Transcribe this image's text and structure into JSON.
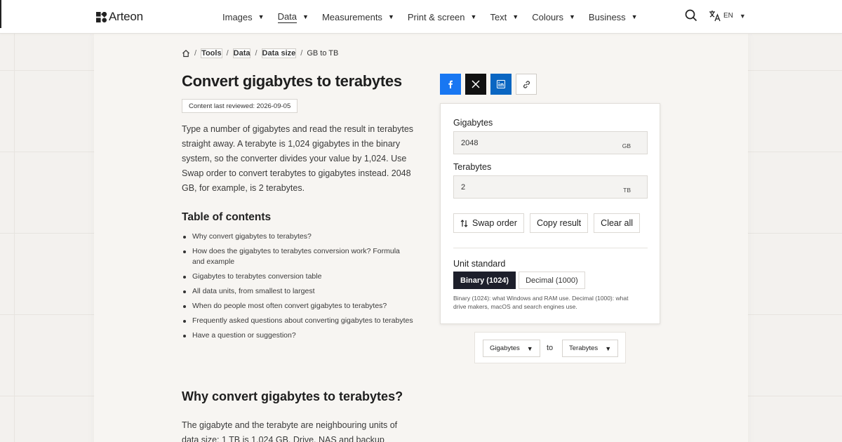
{
  "brand": {
    "name": "Arteon"
  },
  "nav": {
    "items": [
      {
        "label": "Images",
        "active": false
      },
      {
        "label": "Data",
        "active": true
      },
      {
        "label": "Measurements",
        "active": false
      },
      {
        "label": "Print & screen",
        "active": false
      },
      {
        "label": "Text",
        "active": false
      },
      {
        "label": "Colours",
        "active": false
      },
      {
        "label": "Business",
        "active": false
      }
    ],
    "caret": "▼",
    "search_icon": "search-icon",
    "language": {
      "code": "EN",
      "icon": "translate-icon"
    }
  },
  "breadcrumb": {
    "home_icon": "home-icon",
    "items": [
      "Tools",
      "Data",
      "Data size",
      "GB to TB"
    ]
  },
  "page": {
    "title": "Convert gigabytes to terabytes",
    "reviewed": "Content last reviewed: 2026-09-05",
    "intro": "Type a number of gigabytes and read the result in terabytes straight away. A terabyte is 1,024 gigabytes in the binary system, so the converter divides your value by 1,024. Use Swap order to convert terabytes to gigabytes instead. 2048 GB, for example, is 2 terabytes."
  },
  "toc": {
    "title": "Table of contents",
    "items": [
      "Why convert gigabytes to terabytes?",
      "How does the gigabytes to terabytes conversion work? Formula and example",
      "Gigabytes to terabytes conversion table",
      "All data units, from smallest to largest",
      "When do people most often convert gigabytes to terabytes?",
      "Frequently asked questions about converting gigabytes to terabytes",
      "Have a question or suggestion?"
    ]
  },
  "section": {
    "heading": "Why convert gigabytes to terabytes?",
    "text": "The gigabyte and the terabyte are neighbouring units of data size: 1 TB is 1,024 GB. Drive, NAS and backup"
  },
  "share": {
    "icons": [
      "facebook-icon",
      "x-icon",
      "linkedin-icon",
      "link-icon"
    ],
    "colors": {
      "facebook": "#1877f2",
      "x": "#111111",
      "linkedin": "#0a66c2"
    }
  },
  "converter": {
    "from": {
      "label": "Gigabytes",
      "value": "2048",
      "unit": "GB"
    },
    "to": {
      "label": "Terabytes",
      "value": "2",
      "unit": "TB"
    },
    "buttons": {
      "swap": "Swap order",
      "copy": "Copy result",
      "clear": "Clear all"
    },
    "standard": {
      "label": "Unit standard",
      "options": [
        "Binary (1024)",
        "Decimal (1000)"
      ],
      "selected": "Binary (1024)",
      "note": "Binary (1024): what Windows and RAM use. Decimal (1000): what drive makers, macOS and search engines use."
    }
  },
  "unit_select": {
    "from": "Gigabytes",
    "joiner": "to",
    "to": "Terabytes"
  },
  "colors": {
    "accent_dark": "#1d1f2b",
    "page_bg": "#f3f1ee"
  }
}
